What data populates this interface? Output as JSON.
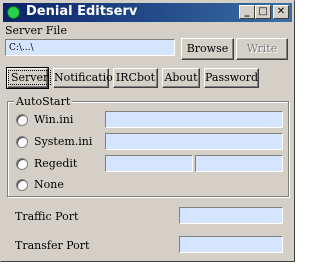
{
  "window": {
    "title": "Denial Editserv",
    "minimize": "_",
    "maximize": "□",
    "close": "✕"
  },
  "server_file": {
    "label": "Server File",
    "value": "C:\\...\\",
    "browse": "Browse",
    "write": "Write"
  },
  "tabs": [
    {
      "label": "Server"
    },
    {
      "label": "Notification"
    },
    {
      "label": "IRCbot"
    },
    {
      "label": "About"
    },
    {
      "label": "Password"
    }
  ],
  "autostart": {
    "title": "AutoStart",
    "options": [
      {
        "label": "Win.ini"
      },
      {
        "label": "System.ini"
      },
      {
        "label": "Regedit"
      },
      {
        "label": "None"
      }
    ]
  },
  "ports": {
    "traffic_label": "Traffic Port",
    "transfer_label": "Transfer Port"
  },
  "colors": {
    "field_bg": "#d6e5ff",
    "titlebar": "#0a246a",
    "face": "#d4d0c8"
  }
}
